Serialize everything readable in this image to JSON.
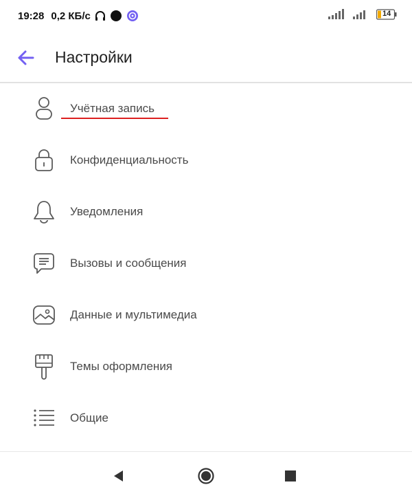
{
  "status": {
    "time": "19:28",
    "speed": "0,2 КБ/с",
    "battery": "14",
    "icons": [
      "headphones-icon",
      "moon-icon",
      "viber-icon",
      "signal-icon",
      "signal-icon",
      "battery-icon"
    ]
  },
  "header": {
    "title": "Настройки"
  },
  "settings": {
    "items": [
      {
        "label": "Учётная запись",
        "icon": "person-icon"
      },
      {
        "label": "Конфиденциальность",
        "icon": "lock-icon"
      },
      {
        "label": "Уведомления",
        "icon": "bell-icon"
      },
      {
        "label": "Вызовы и сообщения",
        "icon": "chat-icon"
      },
      {
        "label": "Данные и мультимедиа",
        "icon": "image-icon"
      },
      {
        "label": "Темы оформления",
        "icon": "brush-icon"
      },
      {
        "label": "Общие",
        "icon": "list-icon"
      }
    ]
  },
  "colors": {
    "accent": "#7360f2",
    "highlight": "#dc1f1f",
    "battery": "#f2a900"
  },
  "navbar": {
    "icons": [
      "back-triangle-icon",
      "home-circle-icon",
      "recents-square-icon"
    ]
  }
}
